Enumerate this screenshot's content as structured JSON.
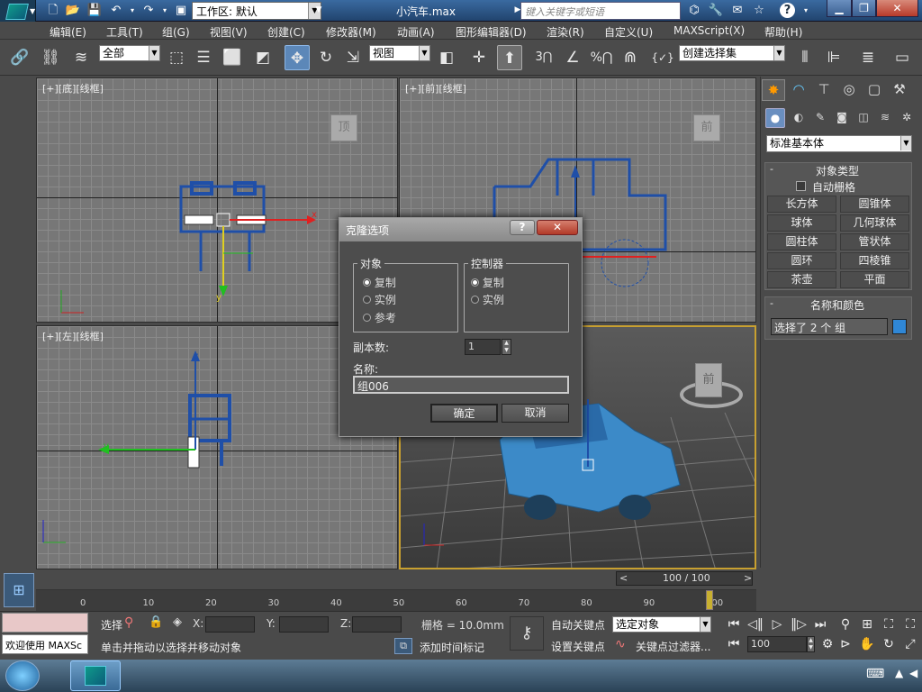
{
  "app": {
    "doc_title": "小汽车.max",
    "workspace_label": "工作区: 默认",
    "search_placeholder": "键入关键字或短语",
    "win_min": "▁",
    "win_max": "❐",
    "win_close": "✕"
  },
  "menu": [
    "编辑(E)",
    "工具(T)",
    "组(G)",
    "视图(V)",
    "创建(C)",
    "修改器(M)",
    "动画(A)",
    "图形编辑器(D)",
    "渲染(R)",
    "自定义(U)",
    "MAXScript(X)",
    "帮助(H)"
  ],
  "toolbar": {
    "filter": "全部",
    "refcoord": "视图",
    "selection_set": "创建选择集",
    "snap3": "3",
    "percent_snap": "%",
    "angle_snap": "∠"
  },
  "viewports": {
    "top": {
      "label": "[+][底][线框]",
      "cube_face": "顶",
      "axis_x": "x",
      "axis_y": "y"
    },
    "front": {
      "label": "[+][前][线框]",
      "cube_face": "前"
    },
    "left": {
      "label": "[+][左][线框]",
      "axis_z": "z",
      "axis_y": "y"
    },
    "persp": {
      "cube_face": "前"
    }
  },
  "panel": {
    "dropdown": "标准基本体",
    "object_type_title": "对象类型",
    "autogrid": "自动栅格",
    "buttons": [
      "长方体",
      "圆锥体",
      "球体",
      "几何球体",
      "圆柱体",
      "管状体",
      "圆环",
      "四棱锥",
      "茶壶",
      "平面"
    ],
    "name_color_title": "名称和颜色",
    "name_value": "选择了 2 个 组",
    "color": "#2f87d6"
  },
  "dialog": {
    "title": "克隆选项",
    "help_btn": "?",
    "close_btn": "✕",
    "object_group": "对象",
    "object_options": [
      "复制",
      "实例",
      "参考"
    ],
    "object_selected": 0,
    "controller_group": "控制器",
    "controller_options": [
      "复制",
      "实例"
    ],
    "controller_selected": 0,
    "copies_label": "副本数:",
    "copies_value": "1",
    "name_label": "名称:",
    "name_value": "组006",
    "ok": "确定",
    "cancel": "取消"
  },
  "timeline": {
    "frame": "100 / 100",
    "ticks": [
      "0",
      "10",
      "20",
      "30",
      "40",
      "50",
      "60",
      "70",
      "80",
      "90",
      "100"
    ],
    "prev": "<",
    "next": ">"
  },
  "status": {
    "welcome": "欢迎使用 MAXSc",
    "select_label": "选择",
    "x_label": "X:",
    "y_label": "Y:",
    "z_label": "Z:",
    "grid": "栅格 = 10.0mm",
    "prompt": "单击并拖动以选择并移动对象",
    "add_time_tag": "添加时间标记",
    "auto_key": "自动关键点",
    "set_key": "设置关键点",
    "selected_object": "选定对象",
    "key_filters": "关键点过滤器...",
    "frame_field": "100"
  }
}
